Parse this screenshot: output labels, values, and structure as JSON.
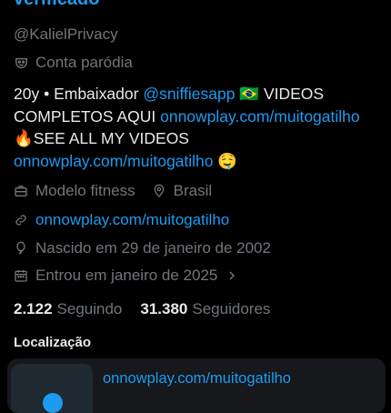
{
  "profile": {
    "name_partial": "verificado",
    "handle": "@KalielPrivacy",
    "parody_label": "Conta paródia",
    "bio": {
      "part1": "20y • Embaixador ",
      "mention": "@sniffiesapp",
      "flag": " 🇧🇷 ",
      "part2": "VIDEOS COMPLETOS AQUI ",
      "link1": "onnowplay.com/muitogatilho",
      "line3_prefix": "🔥SEE ALL MY VIDEOS ",
      "link2": "onnowplay.com/muitogatilho",
      "emoji_end": " 🤤"
    },
    "category": "Modelo fitness",
    "location": "Brasil",
    "website": "onnowplay.com/muitogatilho",
    "birth": "Nascido em 29 de janeiro de 2002",
    "joined": "Entrou em janeiro de 2025",
    "following_count": "2.122",
    "following_label": "Seguindo",
    "followers_count": "31.380",
    "followers_label": "Seguidores"
  },
  "location_section": {
    "title": "Localização",
    "card_link": "onnowplay.com/muitogatilho"
  },
  "icons": {
    "parody": "mask-icon",
    "category": "briefcase-icon",
    "location": "location-pin-icon",
    "website": "link-icon",
    "birth": "balloon-icon",
    "joined": "calendar-icon",
    "joined_chevron": "chevron-right-icon"
  },
  "colors": {
    "background": "#000000",
    "primary_text": "#e7e9ea",
    "secondary_text": "#71767b",
    "accent": "#1d9bf0",
    "card_bg": "#16181c"
  }
}
